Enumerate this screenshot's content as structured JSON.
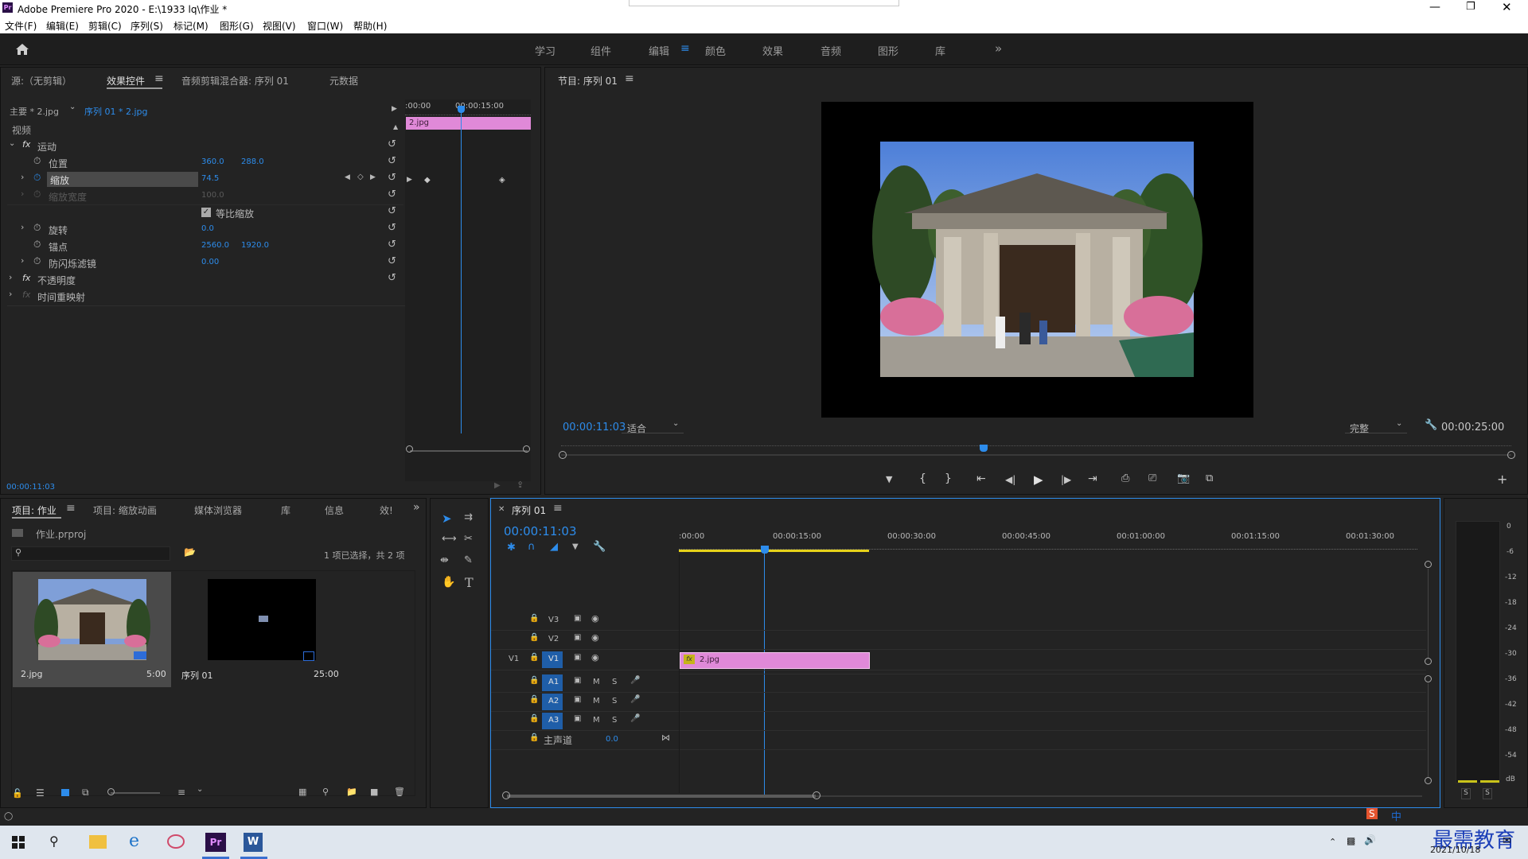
{
  "window": {
    "title": "Adobe Premiere Pro 2020 - E:\\1933 lq\\作业 *",
    "app_badge": "Pr"
  },
  "menu": [
    "文件(F)",
    "编辑(E)",
    "剪辑(C)",
    "序列(S)",
    "标记(M)",
    "图形(G)",
    "视图(V)",
    "窗口(W)",
    "帮助(H)"
  ],
  "workspaces": [
    "学习",
    "组件",
    "编辑",
    "颜色",
    "效果",
    "音频",
    "图形",
    "库"
  ],
  "active_workspace": "编辑",
  "effect_panel": {
    "tabs": [
      "源:（无剪辑）",
      "效果控件",
      "音频剪辑混合器: 序列 01",
      "元数据"
    ],
    "master": "主要 * 2.jpg",
    "sequence": "序列 01 * 2.jpg",
    "tl_start": ":00:00",
    "tl_mid": "00:00:15:00",
    "clip_name": "2.jpg",
    "section_video": "视频",
    "motion": "运动",
    "position_label": "位置",
    "position_x": "360.0",
    "position_y": "288.0",
    "scale_label": "缩放",
    "scale_value": "74.5",
    "scale_width_label": "缩放宽度",
    "scale_width_value": "100.0",
    "uniform_label": "等比缩放",
    "rotation_label": "旋转",
    "rotation_value": "0.0",
    "anchor_label": "锚点",
    "anchor_x": "2560.0",
    "anchor_y": "1920.0",
    "flicker_label": "防闪烁滤镜",
    "flicker_value": "0.00",
    "opacity": "不透明度",
    "time_remap": "时间重映射",
    "timecode": "00:00:11:03"
  },
  "program": {
    "title": "节目: 序列 01",
    "timecode": "00:00:11:03",
    "fit": "适合",
    "quality": "完整",
    "duration": "00:00:25:00"
  },
  "project": {
    "tabs": [
      "项目: 作业",
      "项目: 缩放动画",
      "媒体浏览器",
      "库",
      "信息",
      "效!"
    ],
    "file": "作业.prproj",
    "selection": "1 项已选择，共 2 项",
    "items": [
      {
        "name": "2.jpg",
        "duration": "5:00"
      },
      {
        "name": "序列 01",
        "duration": "25:00"
      }
    ]
  },
  "timeline": {
    "title": "序列 01",
    "timecode": "00:00:11:03",
    "ruler": [
      ":00:00",
      "00:00:15:00",
      "00:00:30:00",
      "00:00:45:00",
      "00:01:00:00",
      "00:01:15:00",
      "00:01:30:00"
    ],
    "video_tracks": [
      "V3",
      "V2",
      "V1"
    ],
    "v1_source": "V1",
    "audio_tracks": [
      "A1",
      "A2",
      "A3"
    ],
    "m_label": "M",
    "s_label": "S",
    "master_label": "主声道",
    "master_value": "0.0",
    "clip": "2.jpg"
  },
  "meter": {
    "labels": [
      "0",
      "-6",
      "-12",
      "-18",
      "-24",
      "-30",
      "-36",
      "-42",
      "-48",
      "-54",
      "dB"
    ],
    "solo": [
      "S",
      "S"
    ]
  },
  "taskbar": {
    "date": "2021/10/18",
    "watermark": "最需教育",
    "ime": "中"
  }
}
